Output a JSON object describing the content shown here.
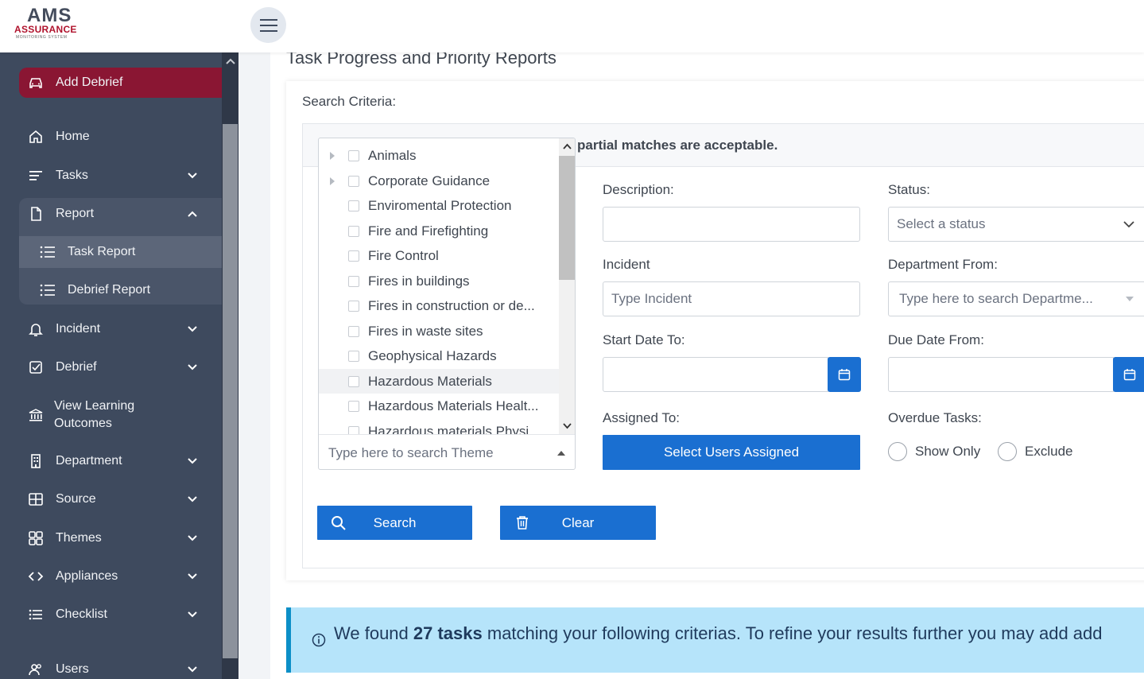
{
  "logo": {
    "line1": "AMS",
    "line2": "ASSURANCE",
    "line3": "MONITORING SYSTEM"
  },
  "sidebar": {
    "add_debrief": "Add Debrief",
    "items": [
      {
        "label": "Home"
      },
      {
        "label": "Tasks"
      },
      {
        "label": "Report"
      },
      {
        "label": "Incident"
      },
      {
        "label": "Debrief"
      },
      {
        "label": "View Learning Outcomes"
      },
      {
        "label": "Department"
      },
      {
        "label": "Source"
      },
      {
        "label": "Themes"
      },
      {
        "label": "Appliances"
      },
      {
        "label": "Checklist"
      },
      {
        "label": "Users"
      }
    ],
    "report_sub": [
      {
        "label": "Task Report"
      },
      {
        "label": "Debrief Report"
      }
    ]
  },
  "page": {
    "title": "Task Progress and Priority Reports"
  },
  "criteria": {
    "label": "Search Criteria:",
    "partial_note": "partial matches are acceptable."
  },
  "theme_tree": {
    "items": [
      {
        "label": "Animals"
      },
      {
        "label": "Corporate Guidance"
      },
      {
        "label": "Enviromental Protection"
      },
      {
        "label": "Fire and Firefighting"
      },
      {
        "label": "Fire Control"
      },
      {
        "label": "Fires in buildings"
      },
      {
        "label": "Fires in construction or de..."
      },
      {
        "label": "Fires in waste sites"
      },
      {
        "label": "Geophysical Hazards"
      },
      {
        "label": "Hazardous Materials"
      },
      {
        "label": "Hazardous Materials Healt..."
      },
      {
        "label": "Hazardous materials Physi..."
      }
    ],
    "search_placeholder": "Type here to search Theme"
  },
  "form": {
    "description_label": "Description:",
    "description_value": "",
    "status_label": "Status:",
    "status_value": "Select a status",
    "incident_label": "Incident",
    "incident_placeholder": "Type Incident",
    "department_label": "Department From:",
    "department_placeholder": "Type here to search Departme...",
    "start_date_label": "Start Date To:",
    "start_date_value": "",
    "due_date_label": "Due Date From:",
    "due_date_value": "",
    "assigned_label": "Assigned To:",
    "assigned_button": "Select Users Assigned",
    "overdue_label": "Overdue Tasks:",
    "overdue_options": [
      "Show Only",
      "Exclude"
    ],
    "search_button": "Search",
    "clear_button": "Clear"
  },
  "banner": {
    "prefix": "We found ",
    "count": "27 tasks",
    "suffix": " matching your following criterias. To refine your results further you may add add"
  },
  "colors": {
    "accent": "#1a6fd1",
    "sidebar": "#3e4a5e",
    "brand": "#8a1633",
    "banner": "#b6e4fa"
  }
}
